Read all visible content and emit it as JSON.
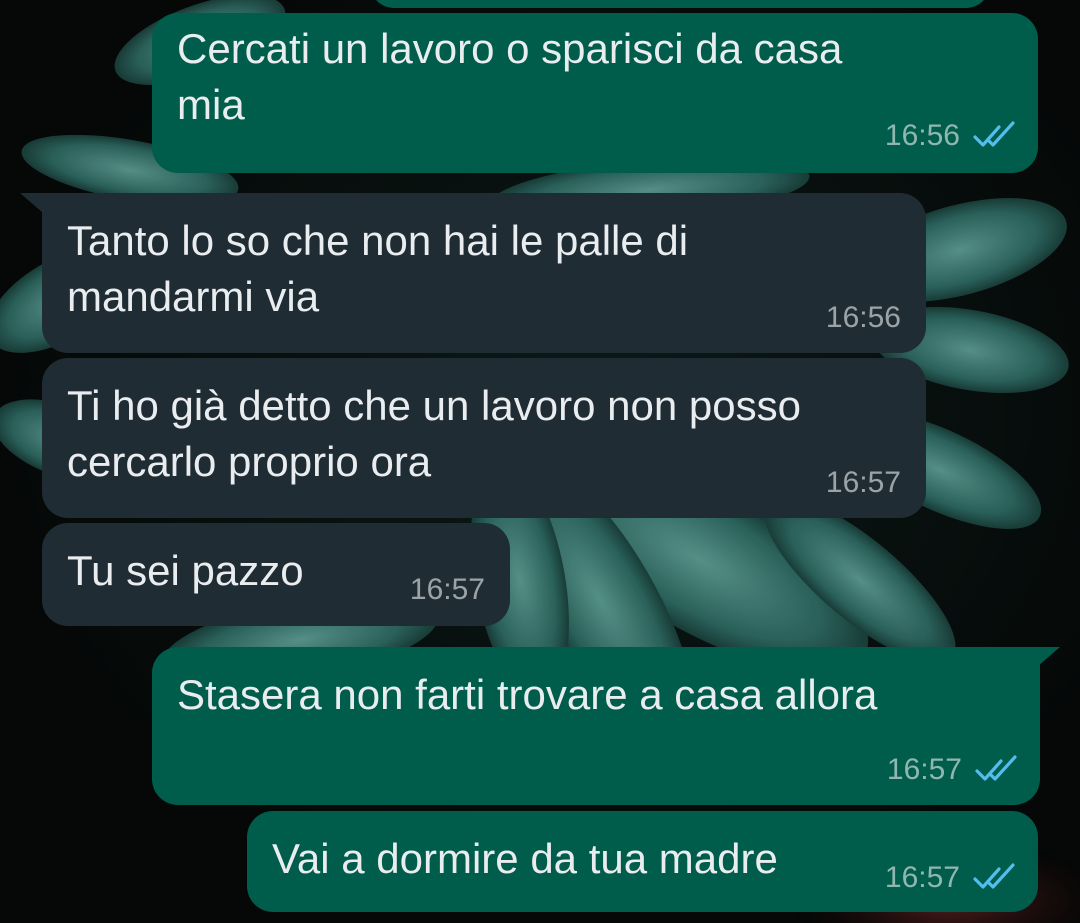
{
  "colors": {
    "outgoing_bubble": "#005c4b",
    "incoming_bubble": "#202c33",
    "text": "#e9edef",
    "read_ticks": "#53bdeb"
  },
  "messages": [
    {
      "direction": "outgoing",
      "text": "Cercati un lavoro o sparisci da casa\nmia",
      "time": "16:56",
      "status": "read-ticks-icon"
    },
    {
      "direction": "incoming",
      "text": "Tanto lo so che non hai le palle di\nmandarmi via",
      "time": "16:56"
    },
    {
      "direction": "incoming",
      "text": "Ti ho già detto che un lavoro non posso\ncercarlo proprio ora",
      "time": "16:57"
    },
    {
      "direction": "incoming",
      "text": "Tu sei pazzo",
      "time": "16:57"
    },
    {
      "direction": "outgoing",
      "text": "Stasera non farti trovare a casa allora",
      "time": "16:57",
      "status": "read-ticks-icon"
    },
    {
      "direction": "outgoing",
      "text": "Vai a dormire da tua madre",
      "time": "16:57",
      "status": "read-ticks-icon"
    }
  ]
}
